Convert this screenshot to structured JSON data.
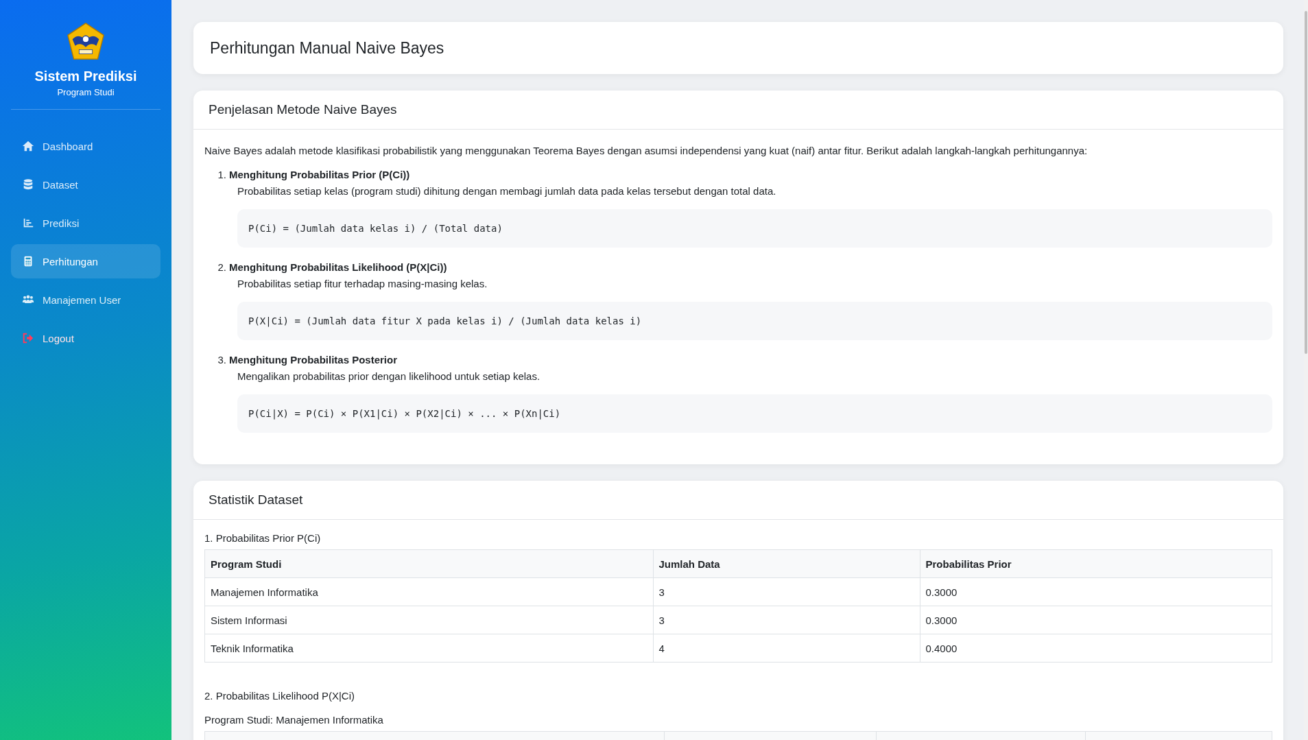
{
  "sidebar": {
    "title": "Sistem Prediksi",
    "subtitle": "Program Studi",
    "items": [
      {
        "label": "Dashboard",
        "kind": "home",
        "selected": false
      },
      {
        "label": "Dataset",
        "kind": "database",
        "selected": false
      },
      {
        "label": "Prediksi",
        "kind": "chart",
        "selected": false
      },
      {
        "label": "Perhitungan",
        "kind": "calculator",
        "selected": true
      },
      {
        "label": "Manajemen User",
        "kind": "users",
        "selected": false
      },
      {
        "label": "Logout",
        "kind": "logout",
        "selected": false
      }
    ]
  },
  "page_title": "Perhitungan Manual Naive Bayes",
  "method_card": {
    "title": "Penjelasan Metode Naive Bayes",
    "intro": "Naive Bayes adalah metode klasifikasi probabilistik yang menggunakan Teorema Bayes dengan asumsi independensi yang kuat (naif) antar fitur. Berikut adalah langkah-langkah perhitungannya:",
    "steps": [
      {
        "number": "1.",
        "title": "Menghitung Probabilitas Prior (P(Ci))",
        "text": "Probabilitas setiap kelas (program studi) dihitung dengan membagi jumlah data pada kelas tersebut dengan total data.",
        "formula": "P(Ci) = (Jumlah data kelas i) / (Total data)"
      },
      {
        "number": "2.",
        "title": "Menghitung Probabilitas Likelihood (P(X|Ci))",
        "text": "Probabilitas setiap fitur terhadap masing-masing kelas.",
        "formula": "P(X|Ci) = (Jumlah data fitur X pada kelas i) / (Jumlah data kelas i)"
      },
      {
        "number": "3.",
        "title": "Menghitung Probabilitas Posterior",
        "text": "Mengalikan probabilitas prior dengan likelihood untuk setiap kelas.",
        "formula": "P(Ci|X) = P(Ci) × P(X1|Ci) × P(X2|Ci) × ... × P(Xn|Ci)"
      }
    ]
  },
  "stats_card": {
    "title": "Statistik Dataset",
    "prior_heading": "1. Probabilitas Prior P(Ci)",
    "prior_table": {
      "columns": [
        "Program Studi",
        "Jumlah Data",
        "Probabilitas Prior"
      ],
      "rows": [
        [
          "Manajemen Informatika",
          "3",
          "0.3000"
        ],
        [
          "Sistem Informasi",
          "3",
          "0.3000"
        ],
        [
          "Teknik Informatika",
          "4",
          "0.4000"
        ]
      ]
    },
    "likelihood_heading": "2. Probabilitas Likelihood P(X|Ci)",
    "program_heading": "Program Studi: Manajemen Informatika"
  }
}
